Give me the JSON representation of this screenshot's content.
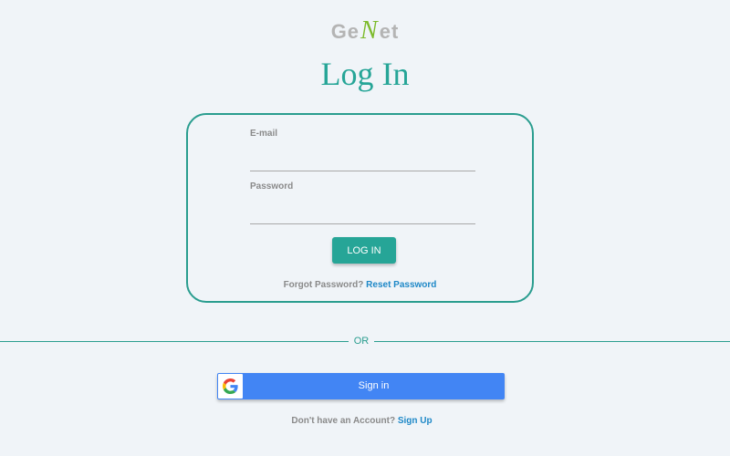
{
  "logo": {
    "part_left": "Ge",
    "part_mark": "N",
    "part_right": "et",
    "mark_color": "#7dbb2c",
    "text_color": "#b4b4b4"
  },
  "title": "Log In",
  "form": {
    "email_label": "E-mail",
    "email_value": "",
    "password_label": "Password",
    "password_value": "",
    "login_button": "LOG IN",
    "forgot_text": "Forgot Password?",
    "reset_link": "Reset Password"
  },
  "divider_text": "OR",
  "google": {
    "icon": "google-g-icon",
    "label": "Sign in",
    "button_color": "#4285f4"
  },
  "signup": {
    "prompt": "Don't have an Account?",
    "link": "Sign Up"
  },
  "colors": {
    "accent": "#26a597",
    "link": "#1e88c7",
    "background": "#f0f4f8"
  }
}
